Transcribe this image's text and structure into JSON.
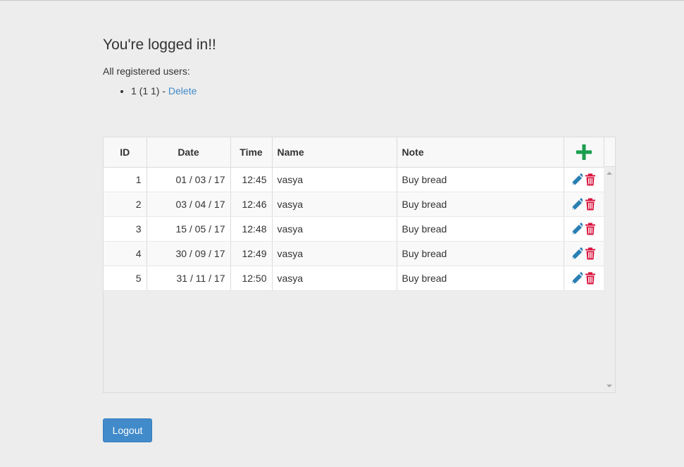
{
  "page": {
    "heading": "You're logged in!!",
    "subtitle": "All registered users:"
  },
  "users": [
    {
      "text": "1 (1 1) - ",
      "delete_label": "Delete"
    }
  ],
  "grid": {
    "columns": [
      "ID",
      "Date",
      "Time",
      "Name",
      "Note"
    ],
    "add_icon": "plus-icon",
    "edit_icon": "pencil-icon",
    "delete_icon": "trash-icon",
    "rows": [
      {
        "id": "1",
        "date": "01 / 03 / 17",
        "time": "12:45",
        "name": "vasya",
        "note": "Buy bread"
      },
      {
        "id": "2",
        "date": "03 / 04 / 17",
        "time": "12:46",
        "name": "vasya",
        "note": "Buy bread"
      },
      {
        "id": "3",
        "date": "15 / 05 / 17",
        "time": "12:48",
        "name": "vasya",
        "note": "Buy bread"
      },
      {
        "id": "4",
        "date": "30 / 09 / 17",
        "time": "12:49",
        "name": "vasya",
        "note": "Buy bread"
      },
      {
        "id": "5",
        "date": "31 / 11 / 17",
        "time": "12:50",
        "name": "vasya",
        "note": "Buy bread"
      }
    ]
  },
  "logout": {
    "label": "Logout"
  },
  "colors": {
    "add": "#1a9e4f",
    "edit": "#2a7fb3",
    "delete": "#d9133c",
    "primary": "#428bca",
    "link": "#428bca"
  }
}
